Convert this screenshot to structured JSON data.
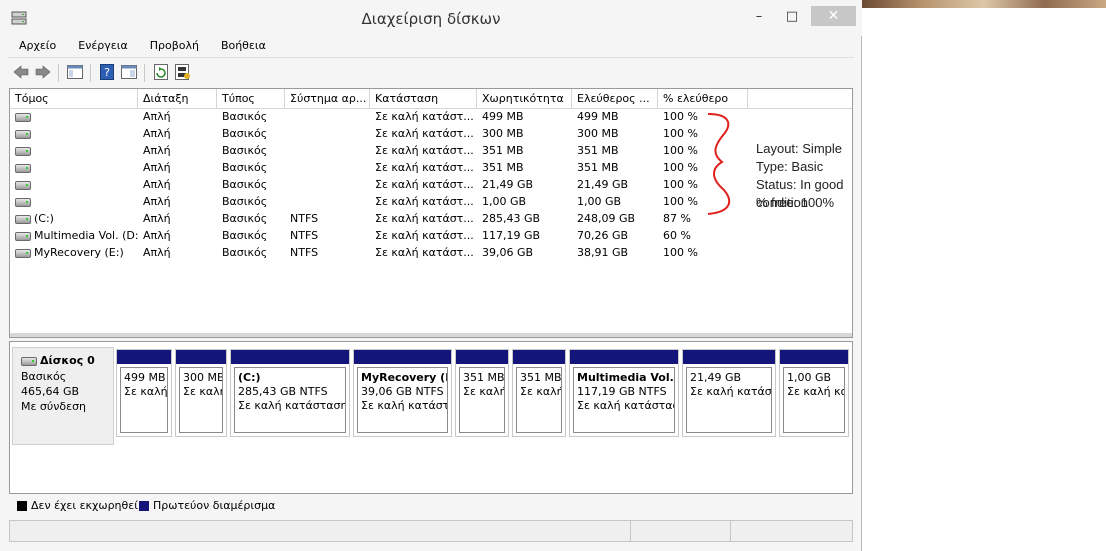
{
  "window": {
    "title": "Διαχείριση δίσκων"
  },
  "menu": [
    "Αρχείο",
    "Ενέργεια",
    "Προβολή",
    "Βοήθεια"
  ],
  "table": {
    "headers": [
      "Τόμος",
      "Διάταξη",
      "Τύπος",
      "Σύστημα αρ...",
      "Κατάσταση",
      "Χωρητικότητα",
      "Ελεύθερος ...",
      "% ελεύθερο"
    ],
    "rows": [
      [
        "",
        "Απλή",
        "Βασικός",
        "",
        "Σε καλή κατάστ...",
        "499 MB",
        "499 MB",
        "100 %"
      ],
      [
        "",
        "Απλή",
        "Βασικός",
        "",
        "Σε καλή κατάστ...",
        "300 MB",
        "300 MB",
        "100 %"
      ],
      [
        "",
        "Απλή",
        "Βασικός",
        "",
        "Σε καλή κατάστ...",
        "351 MB",
        "351 MB",
        "100 %"
      ],
      [
        "",
        "Απλή",
        "Βασικός",
        "",
        "Σε καλή κατάστ...",
        "351 MB",
        "351 MB",
        "100 %"
      ],
      [
        "",
        "Απλή",
        "Βασικός",
        "",
        "Σε καλή κατάστ...",
        "21,49 GB",
        "21,49 GB",
        "100 %"
      ],
      [
        "",
        "Απλή",
        "Βασικός",
        "",
        "Σε καλή κατάστ...",
        "1,00 GB",
        "1,00 GB",
        "100 %"
      ],
      [
        "(C:)",
        "Απλή",
        "Βασικός",
        "NTFS",
        "Σε καλή κατάστ...",
        "285,43 GB",
        "248,09 GB",
        "87 %"
      ],
      [
        "Multimedia Vol. (D:)",
        "Απλή",
        "Βασικός",
        "NTFS",
        "Σε καλή κατάστ...",
        "117,19 GB",
        "70,26 GB",
        "60 %"
      ],
      [
        "MyRecovery (E:)",
        "Απλή",
        "Βασικός",
        "NTFS",
        "Σε καλή κατάστ...",
        "39,06 GB",
        "38,91 GB",
        "100 %"
      ]
    ]
  },
  "annotation": {
    "lines": [
      "Layout: Simple",
      "Type: Basic",
      "Status: In good condition",
      "% free: 100%"
    ],
    "color": "#e0201c"
  },
  "disk": {
    "name": "Δίσκος 0",
    "type": "Βασικός",
    "size": "465,64 GB",
    "status": "Με σύνδεση",
    "partitions": [
      {
        "title": "",
        "size": "499 MB",
        "status": "Σε καλή"
      },
      {
        "title": "",
        "size": "300 MB",
        "status": "Σε καλή"
      },
      {
        "title": "(C:)",
        "size": "285,43 GB NTFS",
        "status": "Σε καλή κατάσταση"
      },
      {
        "title": "MyRecovery  (E",
        "size": "39,06 GB NTFS",
        "status": "Σε καλή κατάστ"
      },
      {
        "title": "",
        "size": "351 MB",
        "status": "Σε καλή"
      },
      {
        "title": "",
        "size": "351 MB",
        "status": "Σε καλή"
      },
      {
        "title": "Multimedia Vol.  (",
        "size": "117,19 GB NTFS",
        "status": "Σε καλή κατάσταση"
      },
      {
        "title": "",
        "size": "21,49 GB",
        "status": "Σε καλή κατάστ"
      },
      {
        "title": "",
        "size": "1,00 GB",
        "status": "Σε καλή κα"
      }
    ]
  },
  "legend": [
    {
      "label": "Δεν έχει εκχωρηθεί",
      "color": "#000000"
    },
    {
      "label": "Πρωτεύον διαμέρισμα",
      "color": "#14157a"
    }
  ],
  "icons": [
    "app-icon",
    "back-arrow-icon",
    "forward-arrow-icon",
    "console-tree-icon",
    "help-icon",
    "properties-icon",
    "refresh-icon",
    "rescan-disks-icon",
    "drive-icon",
    "disk-icon"
  ]
}
